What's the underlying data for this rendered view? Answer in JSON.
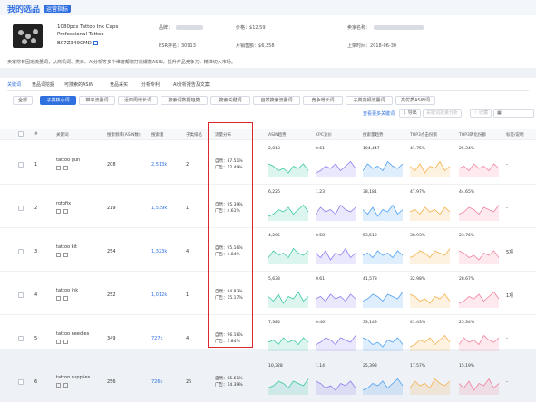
{
  "header": {
    "title": "我的选品",
    "tag": "运营指标"
  },
  "product": {
    "name": "1080pcs Tattoo Ink Caps Professional Tattoo",
    "asin": "B07Z349CMD",
    "brand_label": "品牌：",
    "price_label": "价格：",
    "price": "$12.59",
    "seller_label": "卖家名称：",
    "bsr_label": "BSR排名：",
    "bsr": "30913",
    "sales_label": "月销售额：",
    "sales": "$6,358",
    "launch_label": "上架时间：",
    "launch": "2018-06-30",
    "note": "卖家常有固定流量词，从商机词、类目、AI分析等多个维度帮您打造爆款ASIN，提升产品竞争力，精准切入市场。"
  },
  "tabs": [
    {
      "label": "关键词",
      "active": true
    },
    {
      "label": "竞品词挖掘",
      "active": false
    },
    {
      "label": "可搜索的ASIN",
      "active": false
    },
    {
      "label": "竞品采买",
      "active": false
    },
    {
      "label": "分析专利",
      "active": false
    },
    {
      "label": "AI分析报告及文案",
      "active": false
    }
  ],
  "chips": [
    {
      "label": "全部",
      "active": false
    },
    {
      "label": "子类核心词",
      "active": true
    },
    {
      "label": "带来流量词",
      "active": false
    },
    {
      "label": "近四周增长词",
      "active": false
    },
    {
      "label": "搜索词数据趋势",
      "active": false
    },
    {
      "label": "搜索关键词",
      "active": false
    },
    {
      "label": "自然搜索流量词",
      "active": false
    },
    {
      "label": "竞争增长词",
      "active": false
    },
    {
      "label": "子类高频流量词",
      "active": false
    },
    {
      "label": "高优质ASIN词",
      "active": false
    }
  ],
  "toolbar": {
    "add_keyword": "查看更多关键词",
    "export": "导出",
    "pick_kw": "关键词批量分析",
    "collect": "收藏",
    "top10": ""
  },
  "columns": [
    "#",
    "关键词",
    "搜索频率(ASIN数)",
    "搜索量",
    "子类排名",
    "流量分布",
    "ASIN趋势",
    "CPC竞价",
    "搜索量趋势",
    "TOP3点击份额",
    "TOP3转化份额",
    "标签/说明"
  ],
  "rows": [
    {
      "idx": "1",
      "keyword": "tattoo gun",
      "freq": "208",
      "volume": "2,513k",
      "rank": "2",
      "natural": "自然：87.51%",
      "ad": "广告：12.49%",
      "asin_val": "2,018",
      "cpc_val": "0.61",
      "vol_val": "104,447",
      "ctr_val": "41.75%",
      "cvr_val": "25.34%",
      "tag": "-"
    },
    {
      "idx": "2",
      "keyword": "rotofix",
      "freq": "219",
      "volume": "1,539k",
      "rank": "1",
      "natural": "自然：95.39%",
      "ad": "广告：4.61%",
      "asin_val": "6,226",
      "cpc_val": "1.23",
      "vol_val": "38,181",
      "ctr_val": "47.97%",
      "cvr_val": "44.65%",
      "tag": "-"
    },
    {
      "idx": "3",
      "keyword": "tattoo kit",
      "freq": "254",
      "volume": "1,323k",
      "rank": "4",
      "natural": "自然：95.16%",
      "ad": "广告：4.84%",
      "asin_val": "4,205",
      "cpc_val": "0.58",
      "vol_val": "53,510",
      "ctr_val": "38.93%",
      "cvr_val": "23.76%",
      "tag": "5项"
    },
    {
      "idx": "4",
      "keyword": "tattoo ink",
      "freq": "252",
      "volume": "1,012k",
      "rank": "1",
      "natural": "自然：84.83%",
      "ad": "广告：15.17%",
      "asin_val": "5,638",
      "cpc_val": "0.61",
      "vol_val": "41,578",
      "ctr_val": "32.98%",
      "cvr_val": "28.67%",
      "tag": "1项"
    },
    {
      "idx": "5",
      "keyword": "tattoo needles",
      "freq": "349",
      "volume": "727k",
      "rank": "4",
      "natural": "自然：96.16%",
      "ad": "广告：3.84%",
      "asin_val": "7,385",
      "cpc_val": "0.46",
      "vol_val": "33,149",
      "ctr_val": "41.43%",
      "cvr_val": "25.34%",
      "tag": "-"
    },
    {
      "idx": "6",
      "keyword": "tattoo supplies",
      "freq": "256",
      "volume": "726k",
      "rank": "25",
      "natural": "自然：85.61%",
      "ad": "广告：14.39%",
      "asin_val": "10,328",
      "cpc_val": "1.14",
      "vol_val": "25,398",
      "ctr_val": "17.57%",
      "cvr_val": "15.19%",
      "tag": "-"
    }
  ],
  "colors": {
    "accent": "#2f6fe0",
    "highlight_box": "#d9272e",
    "spark_green": "#3cc9a7",
    "spark_purple": "#8b7ff0",
    "spark_blue": "#4ea1f3",
    "spark_orange": "#f5b14c",
    "spark_pink": "#f2849e"
  }
}
